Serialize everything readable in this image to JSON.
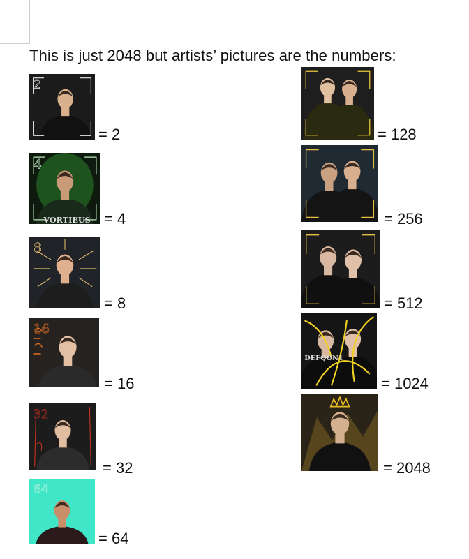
{
  "document": {
    "title": "This is just 2048 but artists’ pictures are the numbers:"
  },
  "images": [
    {
      "alt": "2",
      "label": "= 2",
      "scribble": "2",
      "bg": "#1b1b1b"
    },
    {
      "alt": "4",
      "label": "= 4",
      "scribble": "4",
      "bg": "#0d1a0d",
      "caption": "VORTIEUS"
    },
    {
      "alt": "8",
      "label": "= 8",
      "scribble": "8",
      "bg": "#202428"
    },
    {
      "alt": "16",
      "label": "= 16",
      "scribble": "16",
      "bg": "#26221f"
    },
    {
      "alt": "32",
      "label": "= 32",
      "scribble": "32",
      "bg": "#1c1c1c"
    },
    {
      "alt": "64",
      "label": "= 64",
      "scribble": "64",
      "bg": "#3fe6c8"
    },
    {
      "alt": "128",
      "label": "= 128",
      "bg": "#1e1e1e"
    },
    {
      "alt": "256",
      "label": "= 256",
      "bg": "#1f2a33"
    },
    {
      "alt": "512",
      "label": "= 512",
      "bg": "#1c1c1c"
    },
    {
      "alt": "1024",
      "label": "= 1024",
      "bg": "#151515",
      "caption": "DEFQON1"
    },
    {
      "alt": "2048",
      "label": "= 2048",
      "bg": "#2a2418"
    }
  ]
}
